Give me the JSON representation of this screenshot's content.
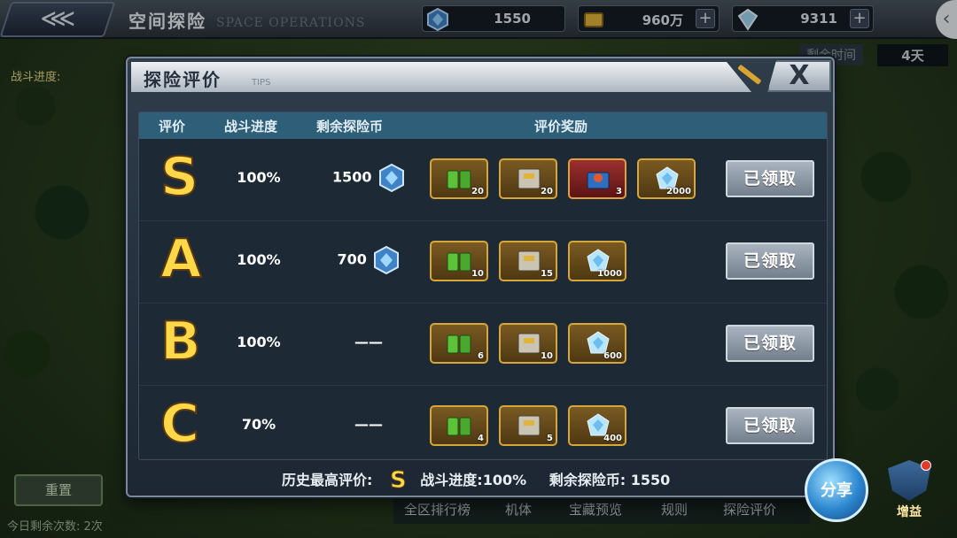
{
  "topbar": {
    "back_symbol": "⋘",
    "title": "空间探险",
    "subtitle": "SPACE OPERATIONS",
    "resources": [
      {
        "icon": "blue-crystal-icon",
        "value": "1550",
        "has_plus": false
      },
      {
        "icon": "gold-bar-icon",
        "value": "960万",
        "has_plus": true
      },
      {
        "icon": "diamond-icon",
        "value": "9311",
        "has_plus": true
      }
    ],
    "plus_symbol": "+",
    "side_handle": "‹"
  },
  "background": {
    "remaining_time_label": "剩余时间",
    "remaining_time_value": "4天",
    "battle_progress_label": "战斗进度:",
    "left_button": "重置",
    "daily_remaining": "今日剩余次数: 2次",
    "tabs": [
      "全区排行榜",
      "机体",
      "宝藏预览",
      "规则",
      "探险评价"
    ],
    "share_label": "分享",
    "boost_label": "增益"
  },
  "modal": {
    "title": "探险评价",
    "tips": "TIPS",
    "close_symbol": "X",
    "headers": {
      "grade": "评价",
      "progress": "战斗进度",
      "coins": "剩余探险币",
      "rewards": "评价奖励"
    },
    "rows": [
      {
        "grade": "S",
        "progress": "100%",
        "coins": "1500",
        "show_coin_icon": true,
        "rewards": [
          {
            "type": "battery",
            "qty": "20"
          },
          {
            "type": "chip",
            "qty": "20"
          },
          {
            "type": "mech-box",
            "qty": "3"
          },
          {
            "type": "crystal",
            "qty": "2000"
          }
        ],
        "button": "已领取"
      },
      {
        "grade": "A",
        "progress": "100%",
        "coins": "700",
        "show_coin_icon": true,
        "rewards": [
          {
            "type": "battery",
            "qty": "10"
          },
          {
            "type": "chip",
            "qty": "15"
          },
          {
            "type": "crystal",
            "qty": "1000"
          }
        ],
        "button": "已领取"
      },
      {
        "grade": "B",
        "progress": "100%",
        "coins": "——",
        "show_coin_icon": false,
        "rewards": [
          {
            "type": "battery",
            "qty": "6"
          },
          {
            "type": "chip",
            "qty": "10"
          },
          {
            "type": "crystal",
            "qty": "600"
          }
        ],
        "button": "已领取"
      },
      {
        "grade": "C",
        "progress": "70%",
        "coins": "——",
        "show_coin_icon": false,
        "rewards": [
          {
            "type": "battery",
            "qty": "4"
          },
          {
            "type": "chip",
            "qty": "5"
          },
          {
            "type": "crystal",
            "qty": "400"
          }
        ],
        "button": "已领取"
      }
    ],
    "footer": {
      "best_label": "历史最高评价:",
      "best_grade": "S",
      "progress_text": "战斗进度:100%",
      "coins_text": "剩余探险币: 1550"
    }
  },
  "colors": {
    "grade_gold": "#ffd84a",
    "header_blue": "#2f5e78",
    "reward_border": "#d5a63a",
    "claimed_grey": "#8c98a5"
  }
}
